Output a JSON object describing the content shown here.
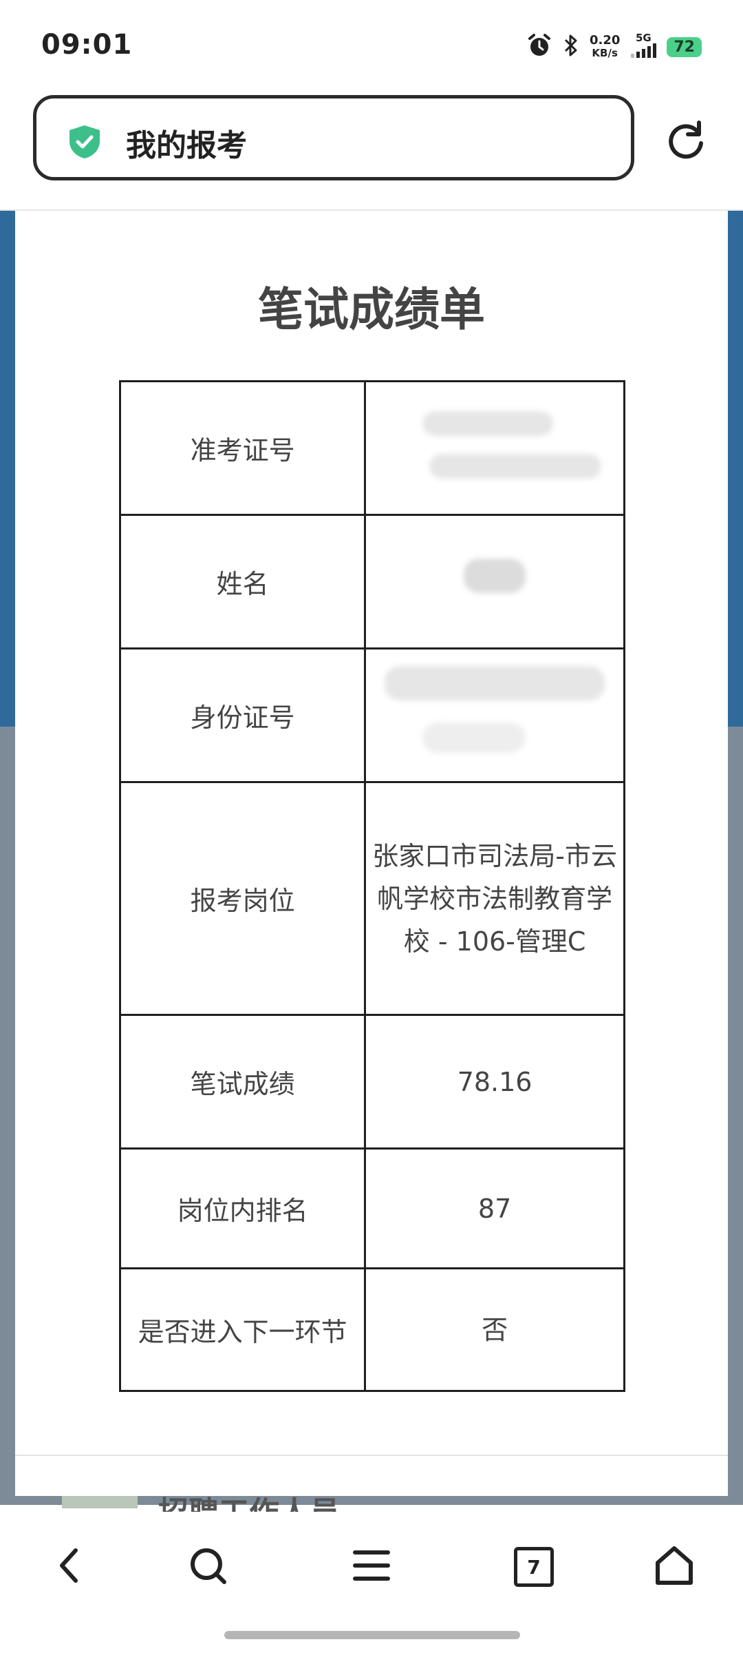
{
  "status_bar": {
    "time": "09:01",
    "net_speed_value": "0.20",
    "net_speed_unit": "KB/s",
    "network": "5G",
    "battery": "72",
    "icons": [
      "alarm-icon",
      "bluetooth-icon",
      "signal-icon"
    ]
  },
  "address_bar": {
    "title": "我的报考",
    "secure_icon": "shield-check-icon",
    "refresh_icon": "refresh-icon"
  },
  "page": {
    "title": "笔试成绩单",
    "rows": [
      {
        "label": "准考证号",
        "value": ""
      },
      {
        "label": "姓名",
        "value": ""
      },
      {
        "label": "身份证号",
        "value": ""
      },
      {
        "label": "报考岗位",
        "value": "张家口市司法局-市云帆学校市法制教育学校 - 106-管理C"
      },
      {
        "label": "笔试成绩",
        "value": "78.16"
      },
      {
        "label": "岗位内排名",
        "value": "87"
      },
      {
        "label": "是否进入下一环节",
        "value": "否"
      }
    ],
    "peek_text": "招聘工作人员"
  },
  "bottom_nav": {
    "tab_count": "7",
    "icons": [
      "back-icon",
      "search-icon",
      "menu-icon",
      "tabs-icon",
      "home-icon"
    ]
  },
  "colors": {
    "accent_green": "#3dbf8a",
    "background_blue": "#2f6a9a",
    "background_grey": "#7d8b98"
  }
}
